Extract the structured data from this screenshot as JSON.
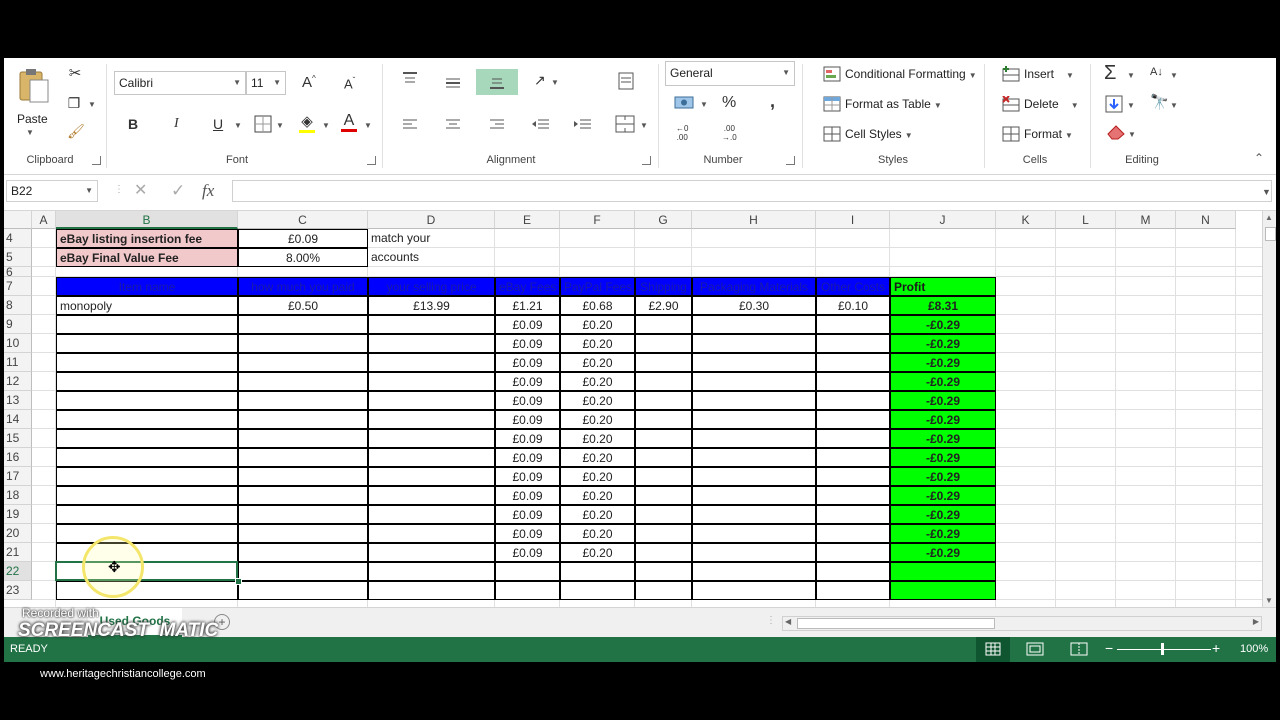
{
  "ribbon": {
    "clipboard": {
      "paste_label": "Paste",
      "group_label": "Clipboard"
    },
    "font": {
      "name": "Calibri",
      "size": "11",
      "group_label": "Font",
      "bold": "B",
      "italic": "I",
      "underline": "U",
      "grow": "A",
      "shrink": "A",
      "color_a": "A"
    },
    "alignment": {
      "group_label": "Alignment"
    },
    "number": {
      "format": "General",
      "group_label": "Number",
      "percent": "%",
      "comma": ",",
      "inc_decimal": "←0\n.00",
      "dec_decimal": ".00\n→.0"
    },
    "styles": {
      "conditional_formatting": "Conditional Formatting",
      "format_as_table": "Format as Table",
      "cell_styles": "Cell Styles",
      "group_label": "Styles"
    },
    "cells": {
      "insert": "Insert",
      "delete": "Delete",
      "format": "Format",
      "group_label": "Cells"
    },
    "editing": {
      "group_label": "Editing"
    }
  },
  "formula_bar": {
    "name_box": "B22",
    "cancel": "✕",
    "enter": "✓",
    "fx": "fx",
    "formula": ""
  },
  "sheet": {
    "columns": [
      "A",
      "B",
      "C",
      "D",
      "E",
      "F",
      "G",
      "H",
      "I",
      "J",
      "K",
      "L",
      "M",
      "N"
    ],
    "selected_column": "B",
    "rows": [
      "4",
      "5",
      "6",
      "7",
      "8",
      "9",
      "10",
      "11",
      "12",
      "13",
      "14",
      "15",
      "16",
      "17",
      "18",
      "19",
      "20",
      "21",
      "22",
      "23"
    ],
    "selected_row": "22",
    "fees": {
      "insertion_label": "eBay listing insertion fee",
      "insertion_value": "£0.09",
      "final_label": "eBay Final Value Fee",
      "final_value": "8.00%",
      "note_line1": "match your",
      "note_line2": "accounts"
    },
    "headers": {
      "item": "Item name",
      "paid": "how much you paid",
      "price": "your selling price",
      "ebay": "eBay Fees",
      "paypal": "PayPal Fees",
      "shipping": "Shipping",
      "packaging": "Packaging Materials",
      "other": "Other Costs",
      "profit": "Profit"
    },
    "row8": {
      "item": "monopoly",
      "paid": "£0.50",
      "price": "£13.99",
      "ebay": "£1.21",
      "paypal": "£0.68",
      "shipping": "£2.90",
      "packaging": "£0.30",
      "other": "£0.10",
      "profit": "£8.31"
    },
    "blank_rows": {
      "ebay": "£0.09",
      "paypal": "£0.20",
      "profit": "-£0.29",
      "count": 13
    }
  },
  "tabs": {
    "active": "Used Goods",
    "add": "+"
  },
  "status": {
    "mode": "READY",
    "zoom": "100%"
  },
  "watermark": {
    "recorded": "Recorded with",
    "brand": "SCREENCAST  MATIC"
  },
  "url_text": "www.heritagechristiancollege.com",
  "colors": {
    "header_blue": "#0000ff",
    "profit_green": "#00ff00",
    "fee_pink": "#f2c9cb",
    "excel_green": "#217346"
  }
}
